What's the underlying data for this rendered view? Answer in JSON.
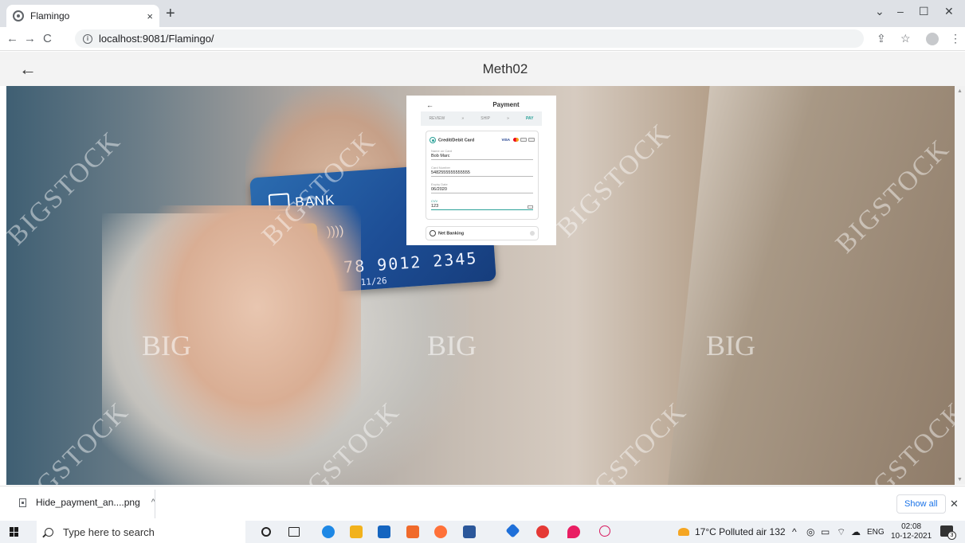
{
  "browser": {
    "tab_title": "Flamingo",
    "tab_close": "×",
    "new_tab": "+",
    "url": "localhost:9081/Flamingo/",
    "window_controls": [
      "⌄",
      "–",
      "☐",
      "✕"
    ]
  },
  "app": {
    "back_arrow": "←",
    "title": "Meth02"
  },
  "hero": {
    "card_bank": "BANK",
    "card_number": "78  9012  2345",
    "card_expiry": "11/26",
    "contactless": "))))",
    "watermarks": [
      "BIGSTOCK",
      "BIG"
    ]
  },
  "payment": {
    "back": "←",
    "title": "Payment",
    "steps": [
      "REVIEW",
      "»",
      "SHIP",
      "»",
      "PAY"
    ],
    "card_option": "Credit/Debit Card",
    "brand_visa": "VISA",
    "fields": [
      {
        "label": "Name on Card",
        "value": "Bob Marc"
      },
      {
        "label": "Card Number",
        "value": "5482555555555555"
      },
      {
        "label": "Expiry Date",
        "value": "06/2020"
      },
      {
        "label": "CVV",
        "value": "123"
      }
    ],
    "net_banking": "Net Banking"
  },
  "downloads": {
    "file": "Hide_payment_an....png",
    "caret": "^",
    "show_all": "Show all",
    "close": "✕"
  },
  "taskbar": {
    "search_placeholder": "Type here to search",
    "weather": "17°C  Polluted air 132",
    "language": "ENG",
    "time": "02:08",
    "date": "10-12-2021",
    "notifications": "3"
  }
}
